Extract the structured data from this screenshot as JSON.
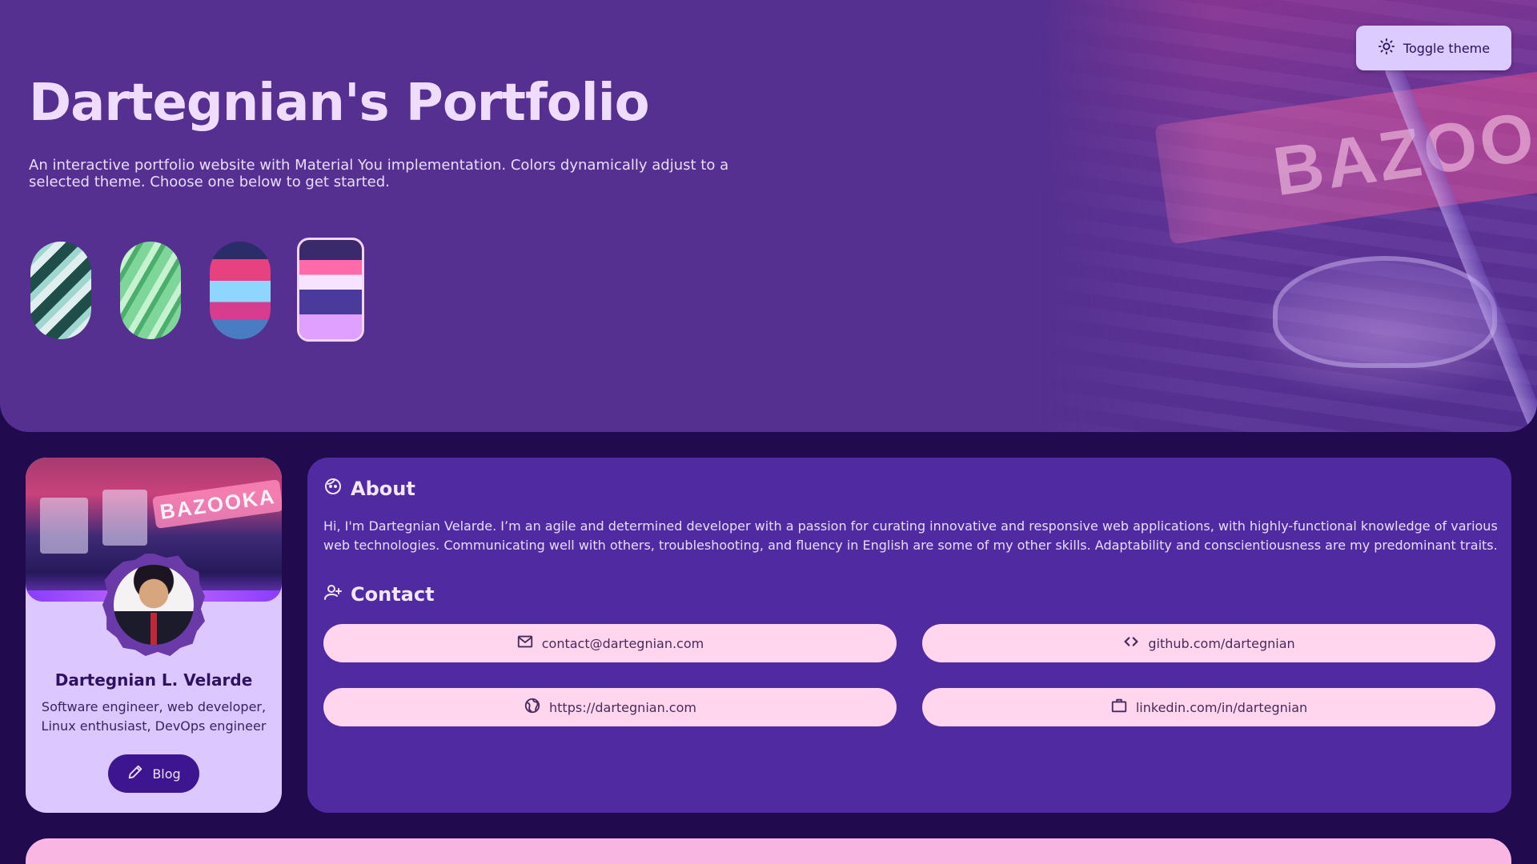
{
  "hero": {
    "title": "Dartegnian's Portfolio",
    "subtitle": "An interactive portfolio website with Material You implementation. Colors dynamically adjust to a selected theme. Choose one below to get started.",
    "art_sign_text": "BAZOOKA",
    "themes": [
      {
        "name": "theme-glass-stairs",
        "selected": false
      },
      {
        "name": "theme-green-waves",
        "selected": false
      },
      {
        "name": "theme-neon-arcade",
        "selected": false
      },
      {
        "name": "theme-bazooka-arcade",
        "selected": true
      }
    ]
  },
  "toggle": {
    "label": "Toggle theme",
    "icon": "sun-icon"
  },
  "profile": {
    "cover_sign_text": "BAZOOKA",
    "name": "Dartegnian L. Velarde",
    "role": "Software engineer, web developer, Linux enthusiast, DevOps engineer",
    "blog_label": "Blog",
    "blog_icon": "pencil-icon"
  },
  "about": {
    "heading": "About",
    "icon": "face-icon",
    "text": "Hi, I'm Dartegnian Velarde. I’m an agile and determined developer with a passion for curating innovative and responsive web applications, with highly-functional knowledge of various web technologies. Communicating well with others, troubleshooting, and fluency in English are some of my other skills. Adaptability and conscientiousness are my predominant traits."
  },
  "contact": {
    "heading": "Contact",
    "icon": "person-add-icon",
    "links": [
      {
        "label": "contact@dartegnian.com",
        "icon": "mail-icon"
      },
      {
        "label": "github.com/dartegnian",
        "icon": "code-icon"
      },
      {
        "label": "https://dartegnian.com",
        "icon": "globe-icon"
      },
      {
        "label": "linkedin.com/in/dartegnian",
        "icon": "briefcase-icon"
      }
    ]
  },
  "colors": {
    "background": "#220a4e",
    "hero": "#553090",
    "primary_container": "#dcc8ff",
    "main_card": "#4f2aa0",
    "chip": "#ffd6ee",
    "blog_button": "#3d1590",
    "bottom_card": "#f9b6e2"
  }
}
